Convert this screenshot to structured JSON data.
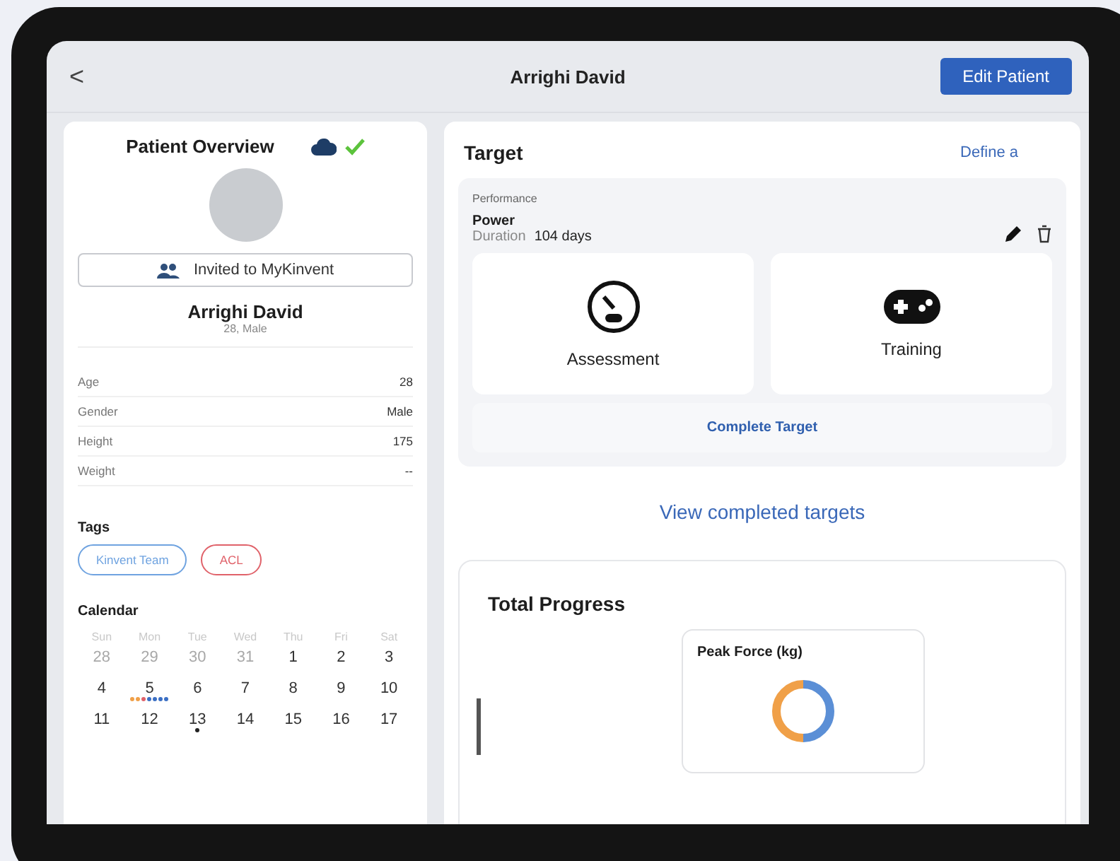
{
  "header": {
    "back": "<",
    "title": "Arrighi David",
    "edit_button": "Edit Patient"
  },
  "overview": {
    "title": "Patient Overview",
    "synced": true,
    "invite_button": "Invited to MyKinvent",
    "name": "Arrighi David",
    "subtitle": "28, Male",
    "fields": [
      {
        "label": "Age",
        "value": "28"
      },
      {
        "label": "Gender",
        "value": "Male"
      },
      {
        "label": "Height",
        "value": "175"
      },
      {
        "label": "Weight",
        "value": "--"
      }
    ],
    "tags_title": "Tags",
    "tags": [
      {
        "label": "Kinvent Team",
        "color": "#6fa3e0"
      },
      {
        "label": "ACL",
        "color": "#e0626a"
      }
    ],
    "calendar_title": "Calendar",
    "weekdays": [
      "Sun",
      "Mon",
      "Tue",
      "Wed",
      "Thu",
      "Fri",
      "Sat"
    ],
    "days": [
      {
        "label": "28",
        "faded": true
      },
      {
        "label": "29",
        "faded": true
      },
      {
        "label": "30",
        "faded": true
      },
      {
        "label": "31",
        "faded": true
      },
      {
        "label": "1",
        "faded": false
      },
      {
        "label": "2",
        "faded": false
      },
      {
        "label": "3",
        "faded": false
      },
      {
        "label": "4",
        "faded": false
      },
      {
        "label": "5",
        "faded": false,
        "events": [
          {
            "color": "#f0a048"
          },
          {
            "color": "#f0a048"
          },
          {
            "color": "#e0626a"
          },
          {
            "color": "#3b6fc4"
          },
          {
            "color": "#3b6fc4"
          },
          {
            "color": "#3b6fc4"
          },
          {
            "color": "#3b6fc4"
          }
        ]
      },
      {
        "label": "6",
        "faded": false
      },
      {
        "label": "7",
        "faded": false
      },
      {
        "label": "8",
        "faded": false
      },
      {
        "label": "9",
        "faded": false
      },
      {
        "label": "10",
        "faded": false
      },
      {
        "label": "11",
        "faded": false
      },
      {
        "label": "12",
        "faded": false
      },
      {
        "label": "13",
        "faded": false,
        "events": [
          {
            "color": "#222222"
          }
        ]
      },
      {
        "label": "14",
        "faded": false
      },
      {
        "label": "15",
        "faded": false
      },
      {
        "label": "16",
        "faded": false
      },
      {
        "label": "17",
        "faded": false
      }
    ]
  },
  "target": {
    "title": "Target",
    "define_link": "Define a",
    "category": "Performance",
    "name": "Power",
    "duration_label": "Duration",
    "duration_value": "104 days",
    "tiles": [
      {
        "kind": "assessment",
        "label": "Assessment"
      },
      {
        "kind": "training",
        "label": "Training"
      }
    ],
    "complete_button": "Complete Target",
    "view_link": "View completed targets"
  },
  "progress": {
    "title": "Total Progress",
    "card_title": "Peak Force (kg)"
  }
}
